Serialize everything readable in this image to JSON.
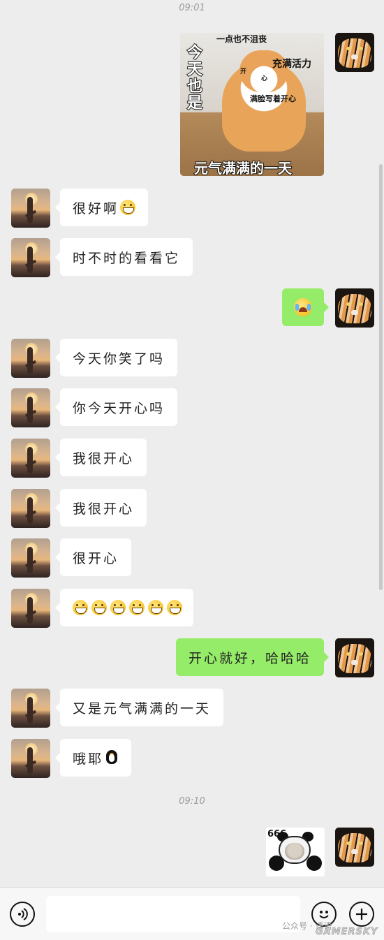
{
  "timestamps": [
    "09:01",
    "09:10"
  ],
  "sticker": {
    "top": "一点也不沮丧",
    "left_vertical": "今天也是",
    "right": "充满活力",
    "small_a": "开",
    "small_b": "心",
    "middle": "满脸写着开心",
    "bottom": "元气满满的一天"
  },
  "messages": {
    "m1": "很好啊",
    "m2": "时不时的看看它",
    "m3": "今天你笑了吗",
    "m4": "你今天开心吗",
    "m5": "我很开心",
    "m6": "我很开心",
    "m7": "很开心",
    "m9": "开心就好，哈哈哈",
    "m10": "又是元气满满的一天",
    "m11": "哦耶"
  },
  "panda_sticker_text": "666",
  "watermark": {
    "account": "公众号 · 语语",
    "site": "GAMERSKY"
  },
  "colors": {
    "background": "#ededed",
    "own_bubble": "#95ec69",
    "other_bubble": "#ffffff"
  },
  "icons": [
    "voice-icon",
    "emoji-icon",
    "plus-icon",
    "grin-emoji-icon",
    "cry-laugh-emoji-icon",
    "penguin-emoji-icon"
  ]
}
